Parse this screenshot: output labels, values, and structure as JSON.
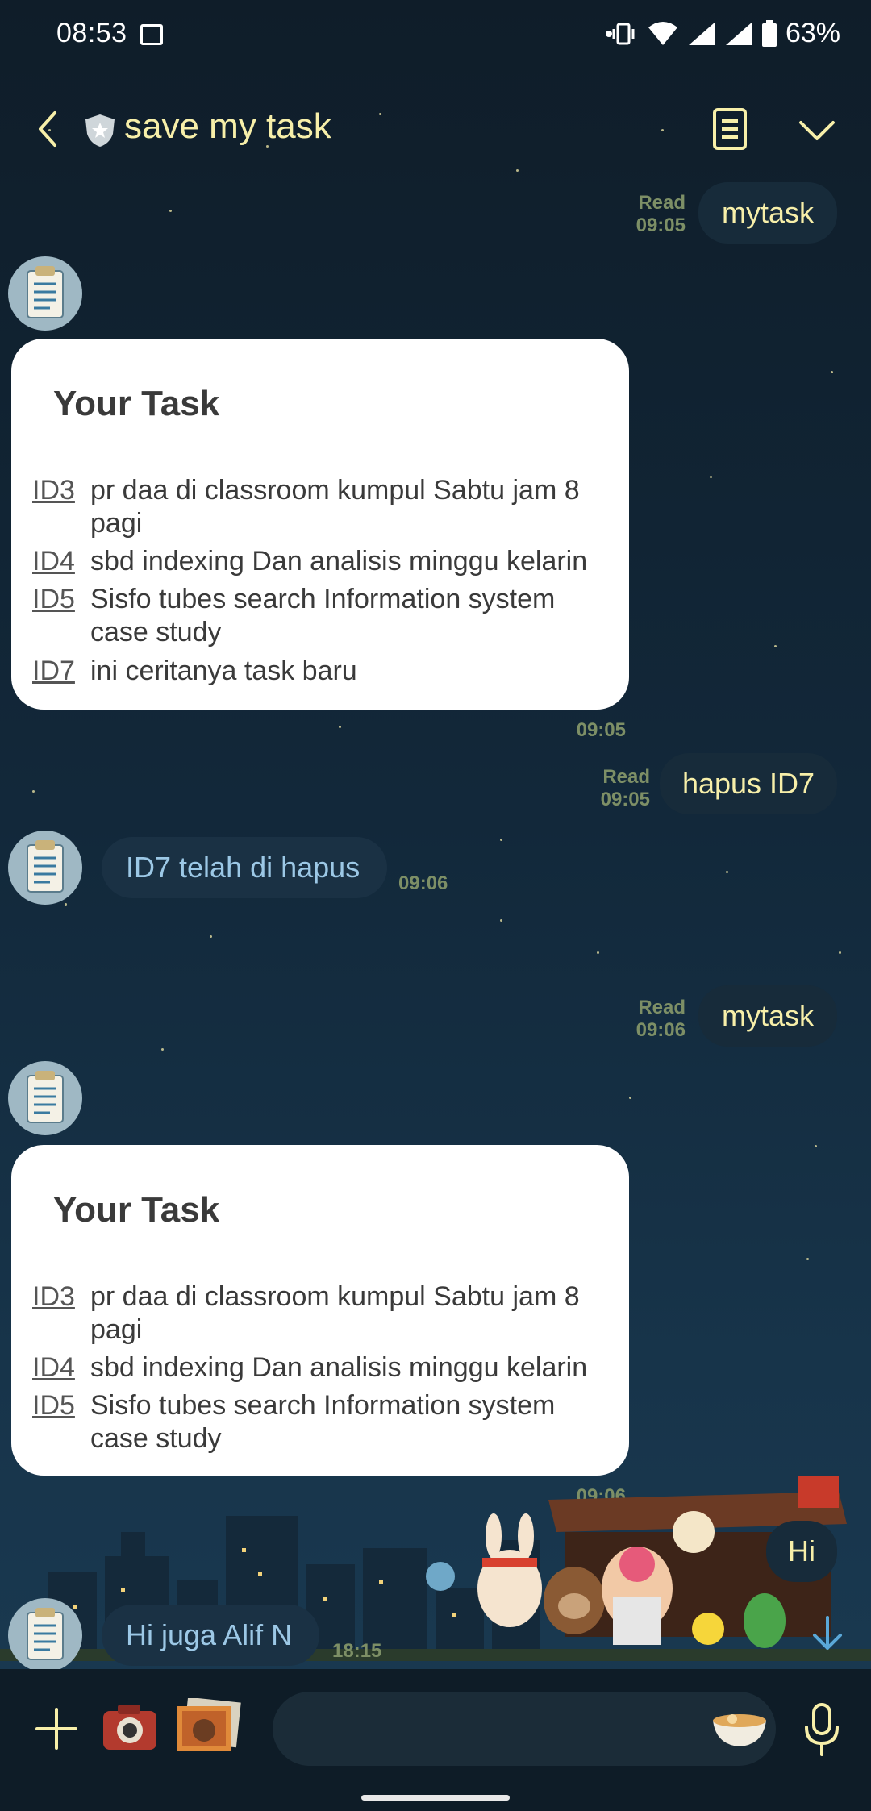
{
  "status_bar": {
    "time": "08:53",
    "battery": "63%"
  },
  "header": {
    "title": "save my task"
  },
  "messages": {
    "m1": {
      "text": "mytask",
      "read": "Read",
      "time": "09:05"
    },
    "card1": {
      "title": "Your Task",
      "tasks": [
        {
          "id": "ID3",
          "text": "pr daa di classroom kumpul Sabtu jam 8 pagi"
        },
        {
          "id": "ID4",
          "text": "sbd indexing Dan analisis minggu kelarin"
        },
        {
          "id": "ID5",
          "text": "Sisfo tubes search Information system case study"
        },
        {
          "id": "ID7",
          "text": "ini ceritanya task baru"
        }
      ],
      "time": "09:05"
    },
    "m2": {
      "text": "hapus ID7",
      "read": "Read",
      "time": "09:05"
    },
    "m3": {
      "text": "ID7 telah di hapus",
      "time": "09:06"
    },
    "m4": {
      "text": "mytask",
      "read": "Read",
      "time": "09:06"
    },
    "card2": {
      "title": "Your Task",
      "tasks": [
        {
          "id": "ID3",
          "text": "pr daa di classroom kumpul Sabtu jam 8 pagi"
        },
        {
          "id": "ID4",
          "text": "sbd indexing Dan analisis minggu kelarin"
        },
        {
          "id": "ID5",
          "text": "Sisfo tubes search Information system case study"
        }
      ],
      "time": "09:06"
    },
    "m5": {
      "text": "Hi"
    },
    "m6": {
      "text": "Hi juga Alif N",
      "time": "18:15"
    }
  },
  "colors": {
    "accent_text": "#f7efa9",
    "incoming_text": "#9cc8e6",
    "meta": "#7d8f66",
    "card_bg": "#ffffff"
  }
}
